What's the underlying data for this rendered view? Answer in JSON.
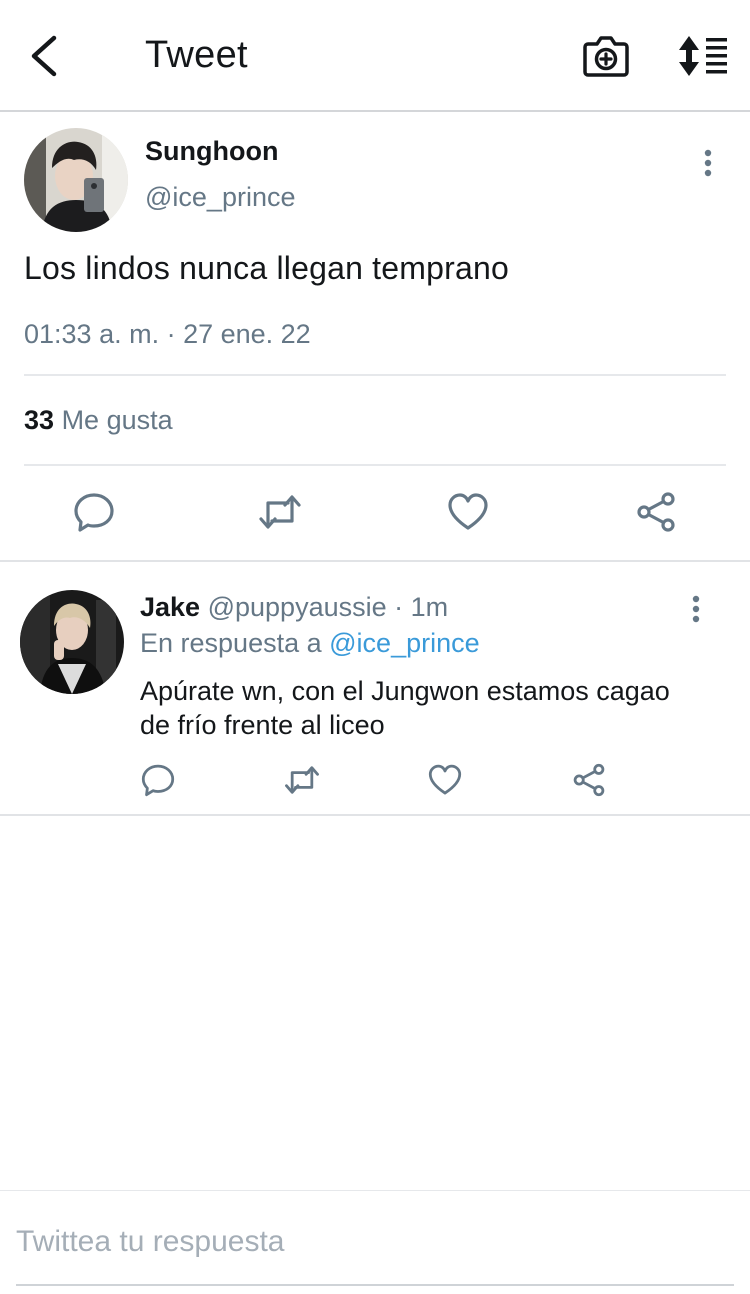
{
  "header": {
    "title": "Tweet",
    "back_icon": "chevron-left-icon",
    "camera_icon": "camera-plus-icon",
    "sort_icon": "sort-list-icon"
  },
  "tweet": {
    "author_name": "Sunghoon",
    "author_handle": "@ice_prince",
    "text": "Los lindos nunca llegan temprano",
    "timestamp": "01:33 a. m. · 27 ene. 22",
    "like_count": "33",
    "like_label": "Me gusta",
    "actions": [
      "reply-icon",
      "retweet-icon",
      "like-icon",
      "share-icon"
    ]
  },
  "reply": {
    "author_name": "Jake",
    "author_handle": "@puppyaussie",
    "separator": "·",
    "time": "1m",
    "in_reply_prefix": "En respuesta a",
    "in_reply_mention": "@ice_prince",
    "text": "Apúrate wn, con el Jungwon estamos cagao de frío frente al liceo"
  },
  "compose": {
    "placeholder": "Twittea tu respuesta",
    "value": ""
  },
  "colors": {
    "text_primary": "#14171a",
    "text_secondary": "#657786",
    "link": "#3a9ad9",
    "icon": "#657786",
    "border": "#e1e3e6"
  }
}
